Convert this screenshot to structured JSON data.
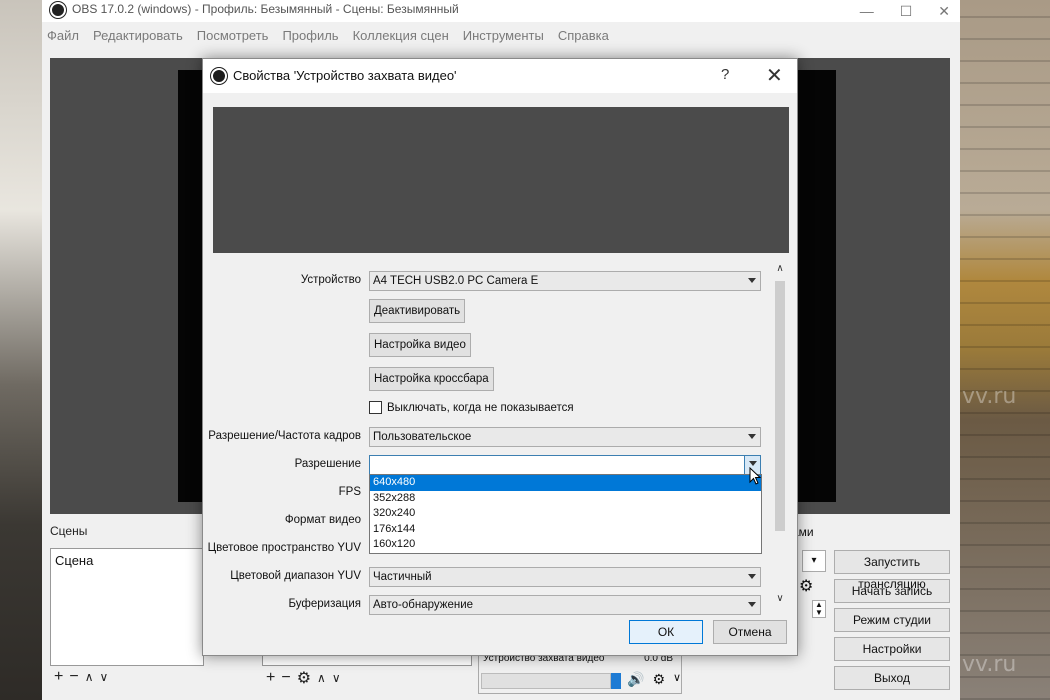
{
  "window": {
    "title": "OBS 17.0.2 (windows) - Профиль: Безымянный - Сцены: Безымянный",
    "controls": [
      "—",
      "☐",
      "✕"
    ]
  },
  "menu": [
    "Файл",
    "Редактировать",
    "Посмотреть",
    "Профиль",
    "Коллекция сцен",
    "Инструменты",
    "Справка"
  ],
  "panels": {
    "scenes_label": "Сцены",
    "scene_item": "Сцена",
    "transitions_label_partial": "ами",
    "mixer": {
      "source": "Устройство захвата видео",
      "db": "0.0 dB"
    }
  },
  "controls_buttons": [
    "Запустить трансляцию",
    "Начать запись",
    "Режим студии",
    "Настройки",
    "Выход"
  ],
  "dialog": {
    "title": "Свойства 'Устройство захвата видео'",
    "help": "?",
    "close": "✕",
    "fields": {
      "device_label": "Устройство",
      "device_value": "A4 TECH USB2.0 PC Camera E",
      "deactivate_button": "Деактивировать",
      "video_settings_button": "Настройка видео",
      "crossbar_button": "Настройка кроссбара",
      "hide_checkbox_label": "Выключать, когда не показывается",
      "res_fps_label": "Разрешение/Частота кадров",
      "res_fps_value": "Пользовательское",
      "resolution_label": "Разрешение",
      "resolution_value": "",
      "fps_label": "FPS",
      "video_format_label": "Формат видео",
      "yuv_space_label": "Цветовое пространство YUV",
      "yuv_range_label": "Цветовой диапазон YUV",
      "yuv_range_value": "Частичный",
      "buffering_label": "Буферизация",
      "buffering_value": "Авто-обнаружение"
    },
    "resolution_options": [
      "640x480",
      "352x288",
      "320x240",
      "176x144",
      "160x120"
    ],
    "resolution_selected_index": 0,
    "ok_button": "ОК",
    "cancel_button": "Отмена"
  },
  "watermark": "vv.ru",
  "colors": {
    "selection": "#0078d7",
    "preview_gray": "#4b4b4b",
    "dialog_bg": "#f0f0f0"
  }
}
